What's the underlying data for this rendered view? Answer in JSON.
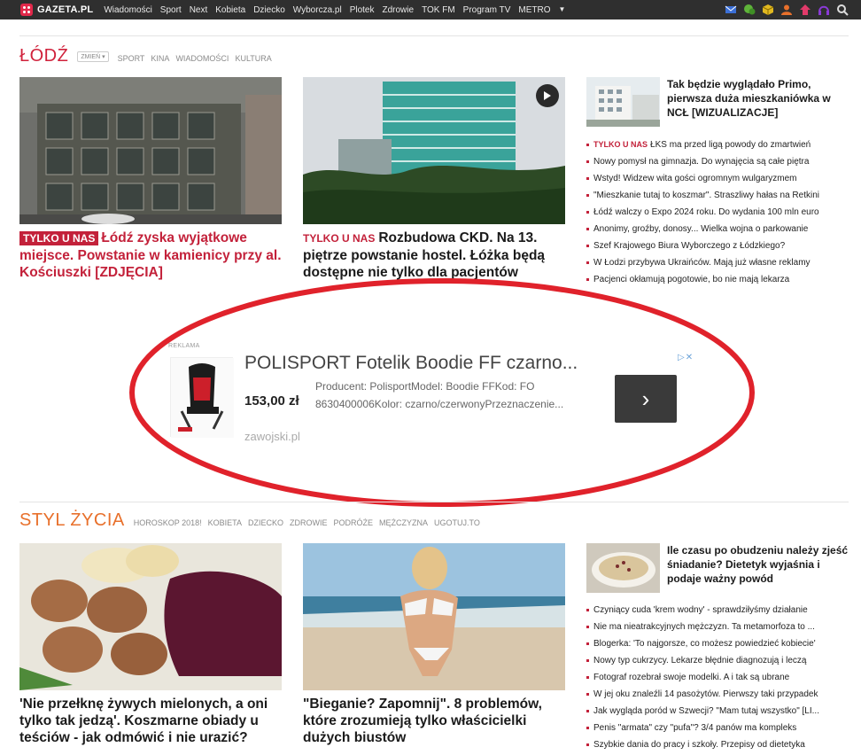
{
  "topbar": {
    "logo": "GAZETA.PL",
    "nav": [
      "Wiadomości",
      "Sport",
      "Next",
      "Kobieta",
      "Dziecko",
      "Wyborcza.pl",
      "Plotek",
      "Zdrowie",
      "TOK FM",
      "Program TV",
      "METRO"
    ],
    "more_glyph": "▼",
    "icons": [
      {
        "name": "mail-icon",
        "color": "#3b6fd6"
      },
      {
        "name": "chat-icon",
        "color": "#5fb43a"
      },
      {
        "name": "box-icon",
        "color": "#e0b820"
      },
      {
        "name": "user-icon",
        "color": "#e8702b"
      },
      {
        "name": "home-icon",
        "color": "#e23a6a"
      },
      {
        "name": "headphones-icon",
        "color": "#8a3ad6"
      },
      {
        "name": "search-icon",
        "color": "#cfcfcf"
      }
    ]
  },
  "lodz": {
    "title": "ŁÓDŹ",
    "change": "ZMIEŃ ▾",
    "links": [
      "SPORT",
      "KINA",
      "WIADOMOŚCI",
      "KULTURA"
    ],
    "article1": {
      "tag": "TYLKO U NAS",
      "title": "Łódź zyska wyjątkowe miejsce. Powstanie w kamienicy przy al. Kościuszki [ZDJĘCIA]"
    },
    "article2": {
      "tag": "TYLKO U NAS",
      "title": "Rozbudowa CKD. Na 13. piętrze powstanie hostel. Łóżka będą dostępne nie tylko dla pacjentów"
    },
    "side": {
      "title": "Tak będzie wyglądało Primo, pierwsza duża mieszkaniówka w NCŁ [WIZUALIZACJE]",
      "first_tag": "TYLKO U NAS",
      "items": [
        "ŁKS ma przed ligą powody do zmartwień",
        "Nowy pomysł na gimnazja. Do wynajęcia są całe piętra",
        "Wstyd! Widzew wita gości ogromnym wulgaryzmem",
        "\"Mieszkanie tutaj to koszmar\". Straszliwy hałas na Retkini",
        "Łódź walczy o Expo 2024 roku. Do wydania 100 mln euro",
        "Anonimy, groźby, donosy... Wielka wojna o parkowanie",
        "Szef Krajowego Biura Wyborczego z Łódzkiego?",
        "W Łodzi przybywa Ukraińców. Mają już własne reklamy",
        "Pacjenci okłamują pogotowie, bo nie mają lekarza"
      ]
    }
  },
  "ad": {
    "label": "REKLAMA",
    "title": "POLISPORT Fotelik Boodie FF czarno...",
    "price": "153,00 zł",
    "description": "Producent: PolisportModel: Boodie FFKod: FO 8630400006Kolor: czarno/czerwonyPrzeznaczenie...",
    "domain": "zawojski.pl",
    "arrow": "›",
    "close": "▷✕"
  },
  "styl": {
    "title": "STYL ŻYCIA",
    "links": [
      "HOROSKOP 2018!",
      "KOBIETA",
      "DZIECKO",
      "ZDROWIE",
      "PODRÓŻE",
      "MĘŻCZYZNA",
      "UGOTUJ.TO"
    ],
    "article1": {
      "title": "'Nie przełknę żywych mielonych, a oni tylko tak jedzą'. Koszmarne obiady u teściów - jak odmówić i nie urazić?"
    },
    "article2": {
      "title": "\"Bieganie? Zapomnij\". 8 problemów, które zrozumieją tylko właścicielki dużych biustów"
    },
    "side": {
      "title": "Ile czasu po obudzeniu należy zjeść śniadanie? Dietetyk wyjaśnia i podaje ważny powód",
      "items": [
        "Czyniący cuda 'krem wodny' - sprawdziłyśmy działanie",
        "Nie ma nieatrakcyjnych mężczyzn. Ta metamorfoza to ...",
        "Blogerka: 'To najgorsze, co możesz powiedzieć kobiecie'",
        "Nowy typ cukrzycy. Lekarze błędnie diagnozują i leczą",
        "Fotograf rozebrał swoje modelki. A i tak są ubrane",
        "W jej oku znaleźli 14 pasożytów. Pierwszy taki przypadek",
        "Jak wygląda poród w Szwecji? \"Mam tutaj wszystko\" [LI...",
        "Penis \"armata\" czy \"pufa\"? 3/4 panów ma kompleks",
        "Szybkie dania do pracy i szkoły. Przepisy od dietetyka"
      ]
    }
  },
  "colors": {
    "accent_red": "#c3213a",
    "orange": "#e8702b",
    "bar": "#2f2f2f",
    "ellipse": "#e0222b"
  }
}
